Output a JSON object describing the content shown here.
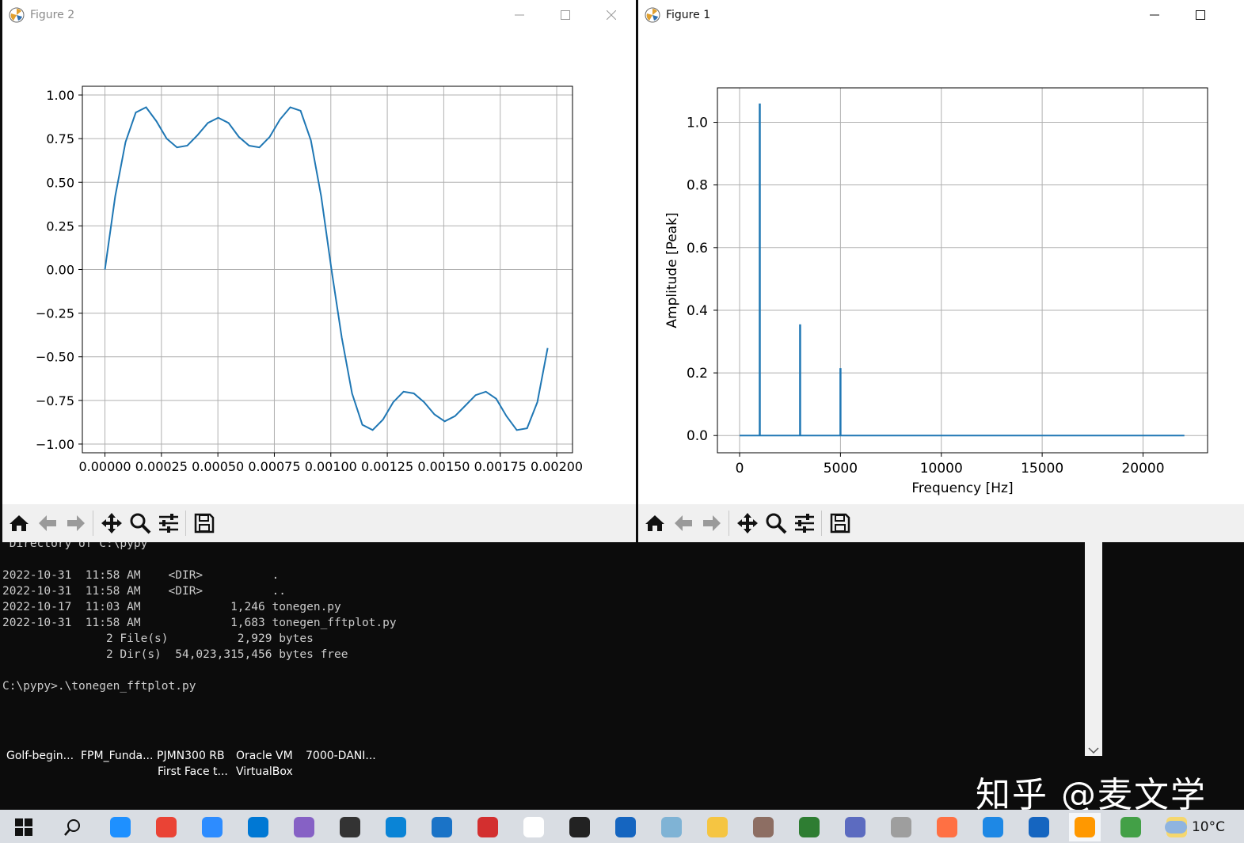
{
  "figure2": {
    "title": "Figure 2",
    "chart_data": {
      "type": "line",
      "x": [
        0,
        5.67e-05,
        0.000113,
        0.00017,
        0.000227,
        0.000283,
        0.00034,
        0.000397,
        0.000454,
        0.00051,
        0.000567,
        0.000624,
        0.00068,
        0.000737,
        0.000794,
        0.00085,
        0.000907,
        0.000964,
        0.00102,
        0.00108,
        0.00113,
        0.00119,
        0.00125,
        0.0013,
        0.00136,
        0.00142,
        0.00147,
        0.00153,
        0.00159,
        0.00164,
        0.0017,
        0.00176,
        0.00181,
        0.00187,
        0.00193,
        0.00198
      ],
      "y": [
        0,
        0.42,
        0.73,
        0.9,
        0.93,
        0.85,
        0.75,
        0.7,
        0.71,
        0.77,
        0.84,
        0.87,
        0.84,
        0.76,
        0.71,
        0.7,
        0.76,
        0.86,
        0.93,
        0.91,
        0.74,
        0.42,
        0.0,
        -0.39,
        -0.71,
        -0.89,
        -0.92,
        -0.86,
        -0.76,
        -0.7,
        -0.71,
        -0.76,
        -0.83,
        -0.87,
        -0.84,
        -0.78,
        -0.72,
        -0.7,
        -0.74,
        -0.84,
        -0.92,
        -0.91,
        -0.76,
        -0.45
      ],
      "xlim": [
        -0.0001,
        0.00207
      ],
      "ylim": [
        -1.05,
        1.05
      ],
      "xticks": [
        0,
        0.00025,
        0.0005,
        0.00075,
        0.001,
        0.00125,
        0.0015,
        0.00175,
        0.002
      ],
      "xtick_labels": [
        "0.00000",
        "0.00025",
        "0.00050",
        "0.00075",
        "0.00100",
        "0.00125",
        "0.00150",
        "0.00175",
        "0.00200"
      ],
      "yticks": [
        1,
        0.75,
        0.5,
        0.25,
        0,
        -0.25,
        -0.5,
        -0.75,
        -1
      ],
      "ytick_labels": [
        "1.00",
        "0.75",
        "0.50",
        "0.25",
        "0.00",
        "−0.25",
        "−0.50",
        "−0.75",
        "−1.00"
      ],
      "grid": true,
      "line_color": "#1f77b4"
    }
  },
  "figure1": {
    "title": "Figure 1",
    "chart_data": {
      "type": "line",
      "xlabel": "Frequency [Hz]",
      "ylabel": "Amplitude [Peak]",
      "xlim": [
        -1100,
        23200
      ],
      "ylim": [
        -0.055,
        1.11
      ],
      "xticks": [
        0,
        5000,
        10000,
        15000,
        20000
      ],
      "xtick_labels": [
        "0",
        "5000",
        "10000",
        "15000",
        "20000"
      ],
      "yticks": [
        0,
        0.2,
        0.4,
        0.6,
        0.8,
        1.0
      ],
      "ytick_labels": [
        "0.0",
        "0.2",
        "0.4",
        "0.6",
        "0.8",
        "1.0"
      ],
      "grid": true,
      "line_color": "#1f77b4",
      "baseline_range": [
        0,
        22050
      ],
      "peaks": [
        {
          "x": 1000,
          "y": 1.06
        },
        {
          "x": 3000,
          "y": 0.355
        },
        {
          "x": 5000,
          "y": 0.215
        }
      ]
    }
  },
  "toolbar_icons": [
    "home-icon",
    "back-arrow-icon",
    "forward-arrow-icon",
    "pan-icon",
    "zoom-icon",
    "configure-subplots-icon",
    "save-icon"
  ],
  "console": {
    "lines": [
      " Directory of C:\\pypy",
      "",
      "2022-10-31  11:58 AM    <DIR>          .",
      "2022-10-31  11:58 AM    <DIR>          ..",
      "2022-10-17  11:03 AM             1,246 tonegen.py",
      "2022-10-31  11:58 AM             1,683 tonegen_fftplot.py",
      "               2 File(s)          2,929 bytes",
      "               2 Dir(s)  54,023,315,456 bytes free",
      "",
      "C:\\pypy>.\\tonegen_fftplot.py"
    ]
  },
  "desktop": {
    "labels_row1": [
      "Golf-begin...",
      "FPM_Funda...",
      "PJMN300 RB",
      "Oracle VM",
      "7000-DANI..."
    ],
    "labels_row2": [
      "First Face t...",
      "VirtualBox"
    ]
  },
  "watermark": "知乎 @麦文学",
  "taskbar": {
    "weather": "10°C",
    "colors": [
      "#1e90ff",
      "#ea4335",
      "#2d8cff",
      "#0078d4",
      "#8661c5",
      "#333333",
      "#0a84d6",
      "#1a73c7",
      "#d32f2f",
      "#ffffff",
      "#222222",
      "#1565c0",
      "#7fb3d5",
      "#f5c542",
      "#8d6e63",
      "#2e7d32",
      "#5c6bc0",
      "#9e9e9e",
      "#ff7043",
      "#1e88e5",
      "#1565c0",
      "#ff9800",
      "#43a047",
      "#f5d76e"
    ]
  }
}
